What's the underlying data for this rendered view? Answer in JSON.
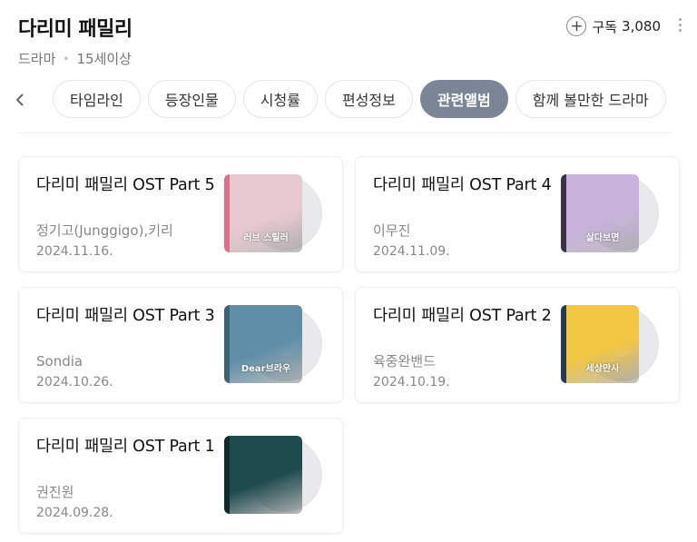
{
  "header": {
    "title": "다리미 패밀리",
    "genre": "드라마",
    "rating": "15세이상",
    "subscribe_label": "구독",
    "subscribe_count": "3,080"
  },
  "tabs": [
    {
      "label": "타임라인",
      "active": false
    },
    {
      "label": "등장인물",
      "active": false
    },
    {
      "label": "시청률",
      "active": false
    },
    {
      "label": "편성정보",
      "active": false
    },
    {
      "label": "관련앨범",
      "active": true
    },
    {
      "label": "함께 볼만한 드라마",
      "active": false
    }
  ],
  "albums": [
    {
      "title": "다리미 패밀리 OST Part 5",
      "artist": "정기고(Junggigo),키리",
      "date": "2024.11.16.",
      "cover_title": "러브 스릴러",
      "cover_color": "#e7c9cf",
      "spine_color": "#e06d8a"
    },
    {
      "title": "다리미 패밀리 OST Part 4",
      "artist": "이무진",
      "date": "2024.11.09.",
      "cover_title": "살다보면",
      "cover_color": "#c9b3dd",
      "spine_color": "#3a3346"
    },
    {
      "title": "다리미 패밀리 OST Part 3",
      "artist": "Sondia",
      "date": "2024.10.26.",
      "cover_title": "Dear브라우",
      "cover_color": "#5f8fa8",
      "spine_color": "#3e6275"
    },
    {
      "title": "다리미 패밀리 OST Part 2",
      "artist": "육중완밴드",
      "date": "2024.10.19.",
      "cover_title": "세상만사",
      "cover_color": "#f3c743",
      "spine_color": "#1f3a5a"
    },
    {
      "title": "다리미 패밀리 OST Part 1",
      "artist": "권진원",
      "date": "2024.09.28.",
      "cover_title": "",
      "cover_color": "#1f4a4e",
      "spine_color": "#0f2a2d"
    }
  ],
  "icons": {
    "subscribe": "plus-circle-icon",
    "more": "more-vertical-icon",
    "prev": "chevron-left-icon"
  }
}
